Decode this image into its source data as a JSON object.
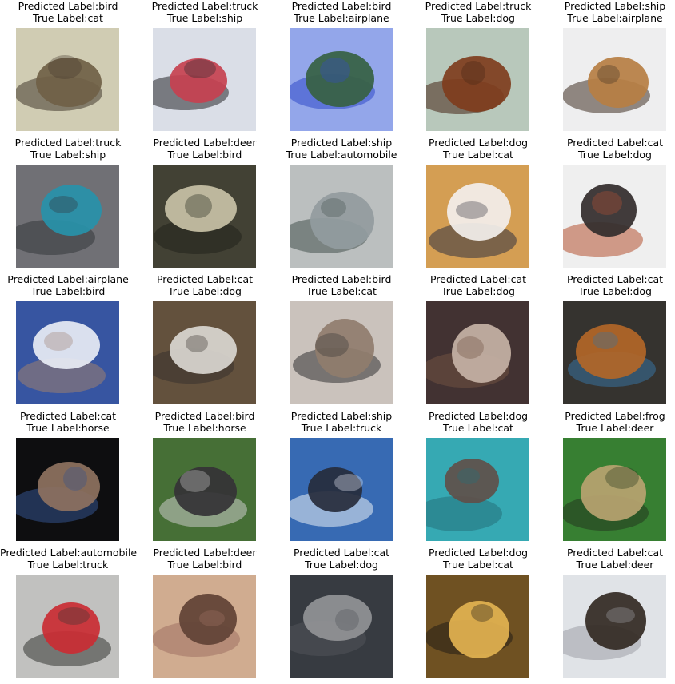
{
  "figure": {
    "cells": [
      {
        "predicted_text": "Predicted Label:bird",
        "true_text": "True Label:cat",
        "predicted": "bird",
        "true": "cat",
        "palette": {
          "bg": "#cfcab0",
          "accent": "#6a5a3f",
          "shadow": "#3b3124"
        }
      },
      {
        "predicted_text": "Predicted Label:truck",
        "true_text": "True Label:ship",
        "predicted": "truck",
        "true": "ship",
        "palette": {
          "bg": "#d9dde7",
          "accent": "#c4394a",
          "shadow": "#1f1f22"
        }
      },
      {
        "predicted_text": "Predicted Label:bird",
        "true_text": "True Label:airplane",
        "predicted": "bird",
        "true": "airplane",
        "palette": {
          "bg": "#8fa3ea",
          "accent": "#2f5a3b",
          "shadow": "#2a46c7"
        }
      },
      {
        "predicted_text": "Predicted Label:truck",
        "true_text": "True Label:dog",
        "predicted": "truck",
        "true": "dog",
        "palette": {
          "bg": "#b6c6b9",
          "accent": "#7a3515",
          "shadow": "#3e1d0c"
        }
      },
      {
        "predicted_text": "Predicted Label:ship",
        "true_text": "True Label:airplane",
        "predicted": "ship",
        "true": "airplane",
        "palette": {
          "bg": "#eeeeef",
          "accent": "#b47a3c",
          "shadow": "#3b2a1c"
        }
      },
      {
        "predicted_text": "Predicted Label:truck",
        "true_text": "True Label:ship",
        "predicted": "truck",
        "true": "ship",
        "palette": {
          "bg": "#6b6b70",
          "accent": "#1f8ea7",
          "shadow": "#2c2f35"
        }
      },
      {
        "predicted_text": "Predicted Label:deer",
        "true_text": "True Label:bird",
        "predicted": "deer",
        "true": "bird",
        "palette": {
          "bg": "#3b3a2c",
          "accent": "#c7c0a3",
          "shadow": "#1a1a14"
        }
      },
      {
        "predicted_text": "Predicted Label:ship",
        "true_text": "True Label:automobile",
        "predicted": "ship",
        "true": "automobile",
        "palette": {
          "bg": "#b9bdbd",
          "accent": "#8e989b",
          "shadow": "#3e4a47"
        }
      },
      {
        "predicted_text": "Predicted Label:dog",
        "true_text": "True Label:cat",
        "predicted": "dog",
        "true": "cat",
        "palette": {
          "bg": "#d39b4c",
          "accent": "#f3efec",
          "shadow": "#2a2a3a"
        }
      },
      {
        "predicted_text": "Predicted Label:cat",
        "true_text": "True Label:dog",
        "predicted": "cat",
        "true": "dog",
        "palette": {
          "bg": "#efefef",
          "accent": "#2a2424",
          "shadow": "#b24a2a"
        }
      },
      {
        "predicted_text": "Predicted Label:airplane",
        "true_text": "True Label:bird",
        "predicted": "airplane",
        "true": "bird",
        "palette": {
          "bg": "#2f4f9e",
          "accent": "#e8ecf5",
          "shadow": "#9a7a6a"
        }
      },
      {
        "predicted_text": "Predicted Label:cat",
        "true_text": "True Label:dog",
        "predicted": "cat",
        "true": "dog",
        "palette": {
          "bg": "#5d4a36",
          "accent": "#d9d5cf",
          "shadow": "#2f2a24"
        }
      },
      {
        "predicted_text": "Predicted Label:bird",
        "true_text": "True Label:cat",
        "predicted": "bird",
        "true": "cat",
        "palette": {
          "bg": "#c8c0ba",
          "accent": "#8c7768",
          "shadow": "#2b2a2b"
        }
      },
      {
        "predicted_text": "Predicted Label:cat",
        "true_text": "True Label:dog",
        "predicted": "cat",
        "true": "dog",
        "palette": {
          "bg": "#3b2a2a",
          "accent": "#c4b0a2",
          "shadow": "#6b4b38"
        }
      },
      {
        "predicted_text": "Predicted Label:cat",
        "true_text": "True Label:dog",
        "predicted": "cat",
        "true": "dog",
        "palette": {
          "bg": "#2d2b27",
          "accent": "#b0611f",
          "shadow": "#2f6e9d"
        }
      },
      {
        "predicted_text": "Predicted Label:cat",
        "true_text": "True Label:horse",
        "predicted": "cat",
        "true": "horse",
        "palette": {
          "bg": "#050507",
          "accent": "#8a6c5a",
          "shadow": "#2a4a88"
        }
      },
      {
        "predicted_text": "Predicted Label:bird",
        "true_text": "True Label:horse",
        "predicted": "bird",
        "true": "horse",
        "palette": {
          "bg": "#3f6a2e",
          "accent": "#2c2a2f",
          "shadow": "#c8c9c8"
        }
      },
      {
        "predicted_text": "Predicted Label:ship",
        "true_text": "True Label:truck",
        "predicted": "ship",
        "true": "truck",
        "palette": {
          "bg": "#2f64b0",
          "accent": "#1e2434",
          "shadow": "#e8eef5"
        }
      },
      {
        "predicted_text": "Predicted Label:dog",
        "true_text": "True Label:cat",
        "predicted": "dog",
        "true": "cat",
        "palette": {
          "bg": "#2ea6b0",
          "accent": "#5a4a42",
          "shadow": "#1d6b76"
        }
      },
      {
        "predicted_text": "Predicted Label:frog",
        "true_text": "True Label:deer",
        "predicted": "frog",
        "true": "deer",
        "palette": {
          "bg": "#2f7a2a",
          "accent": "#b6a06a",
          "shadow": "#1c2f15"
        }
      },
      {
        "predicted_text": "Predicted Label:automobile",
        "true_text": "True Label:truck",
        "predicted": "automobile",
        "true": "truck",
        "palette": {
          "bg": "#bfbfbd",
          "accent": "#c8242b",
          "shadow": "#2e2f2c"
        }
      },
      {
        "predicted_text": "Predicted Label:deer",
        "true_text": "True Label:bird",
        "predicted": "deer",
        "true": "bird",
        "palette": {
          "bg": "#cfa98c",
          "accent": "#5a3b2e",
          "shadow": "#9a6c5c"
        }
      },
      {
        "predicted_text": "Predicted Label:cat",
        "true_text": "True Label:dog",
        "predicted": "cat",
        "true": "dog",
        "palette": {
          "bg": "#2f343a",
          "accent": "#8e8f92",
          "shadow": "#4a4c52"
        }
      },
      {
        "predicted_text": "Predicted Label:dog",
        "true_text": "True Label:cat",
        "predicted": "dog",
        "true": "cat",
        "palette": {
          "bg": "#6a4a1a",
          "accent": "#e2b04a",
          "shadow": "#1a140d"
        }
      },
      {
        "predicted_text": "Predicted Label:cat",
        "true_text": "True Label:deer",
        "predicted": "cat",
        "true": "deer",
        "palette": {
          "bg": "#dfe2e6",
          "accent": "#2a211a",
          "shadow": "#9a9da4"
        }
      }
    ]
  }
}
